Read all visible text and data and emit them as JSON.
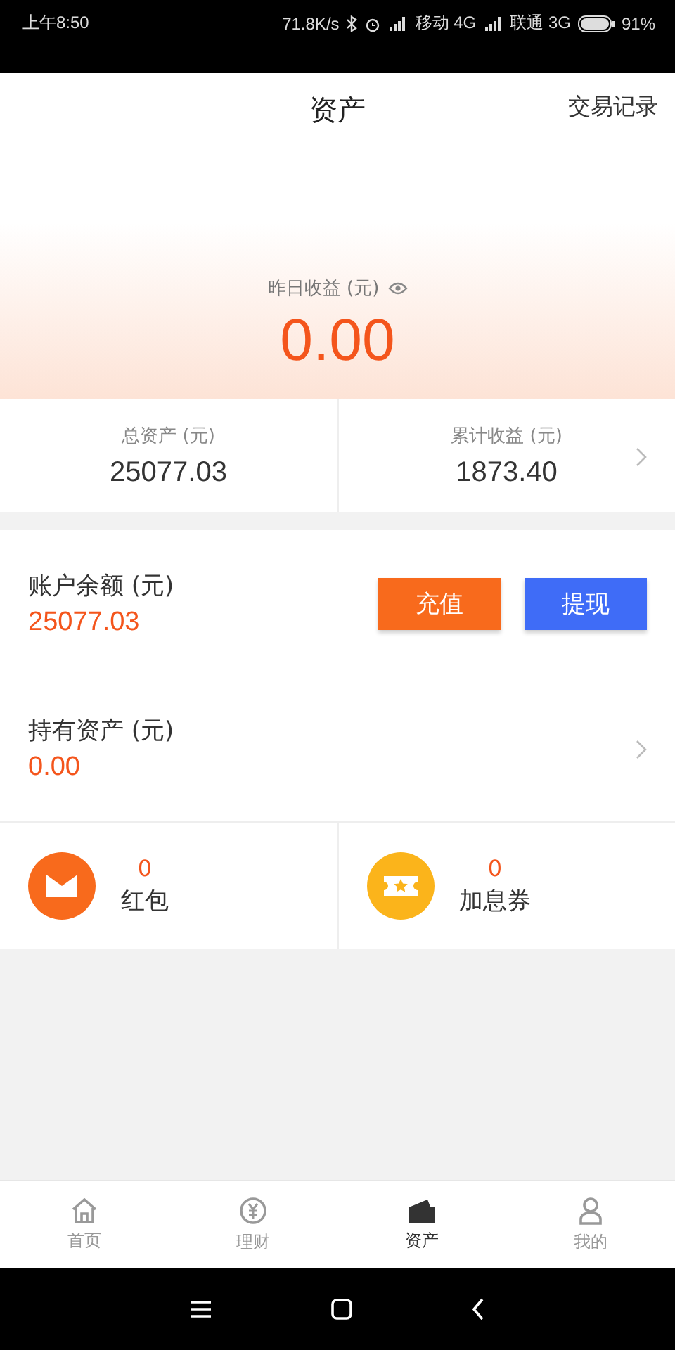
{
  "status_bar": {
    "time": "上午8:50",
    "speed": "71.8K/s",
    "carrier_1": "移动 4G",
    "carrier_2": "联通 3G",
    "battery": "91%"
  },
  "header": {
    "title": "资产",
    "action": "交易记录"
  },
  "hero": {
    "label": "昨日收益 (元)",
    "value": "0.00"
  },
  "summary": [
    {
      "label": "总资产 (元)",
      "value": "25077.03",
      "chevron": false
    },
    {
      "label": "累计收益 (元)",
      "value": "1873.40",
      "chevron": true
    }
  ],
  "balance": {
    "label": "账户余额 (元)",
    "value": "25077.03",
    "buttons": [
      {
        "label": "充值",
        "kind": "primary"
      },
      {
        "label": "提现",
        "kind": "secondary"
      }
    ]
  },
  "holdings": {
    "label": "持有资产 (元)",
    "value": "0.00"
  },
  "bonuses": [
    {
      "kind": "envelope",
      "count": "0",
      "label": "红包"
    },
    {
      "kind": "ticket",
      "count": "0",
      "label": "加息券"
    }
  ],
  "tabs": [
    {
      "kind": "home",
      "label": "首页",
      "selected": false
    },
    {
      "kind": "yen",
      "label": "理财",
      "selected": false
    },
    {
      "kind": "wallet",
      "label": "资产",
      "selected": true
    },
    {
      "kind": "user",
      "label": "我的",
      "selected": false
    }
  ]
}
